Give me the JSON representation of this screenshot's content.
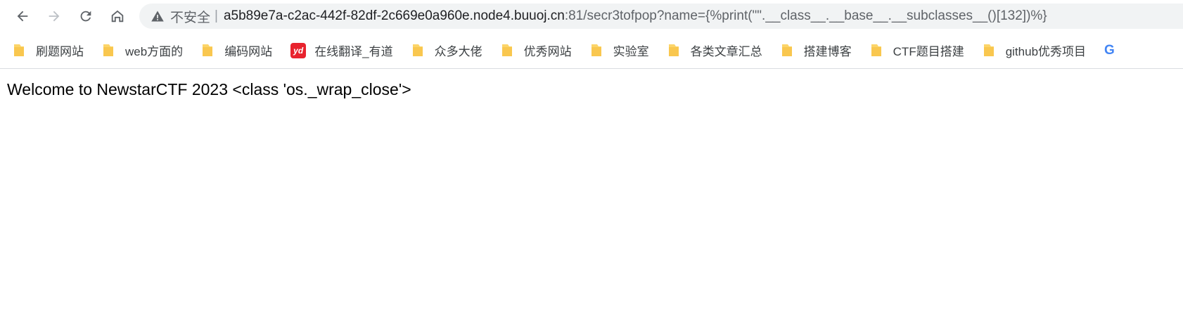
{
  "toolbar": {
    "security_label": "不安全",
    "separator": "|",
    "url_host": "a5b89e7a-c2ac-442f-82df-2c669e0a960e.node4.buuoj.cn",
    "url_rest": ":81/secr3tofpop?name={%print(\"\".__class__.__base__.__subclasses__()[132])%}"
  },
  "bookmarks": [
    {
      "label": "刷题网站",
      "icon": "folder-icon"
    },
    {
      "label": "web方面的",
      "icon": "folder-icon"
    },
    {
      "label": "编码网站",
      "icon": "folder-icon"
    },
    {
      "label": "在线翻译_有道",
      "icon": "youdao-icon",
      "icon_text": "yd"
    },
    {
      "label": "众多大佬",
      "icon": "folder-icon"
    },
    {
      "label": "优秀网站",
      "icon": "folder-icon"
    },
    {
      "label": "实验室",
      "icon": "folder-icon"
    },
    {
      "label": "各类文章汇总",
      "icon": "folder-icon"
    },
    {
      "label": "搭建博客",
      "icon": "folder-icon"
    },
    {
      "label": "CTF题目搭建",
      "icon": "folder-icon"
    },
    {
      "label": "github优秀项目",
      "icon": "folder-icon"
    },
    {
      "label": "G",
      "icon": "google-icon"
    }
  ],
  "page": {
    "text": "Welcome to NewstarCTF 2023 <class 'os._wrap_close'>"
  }
}
